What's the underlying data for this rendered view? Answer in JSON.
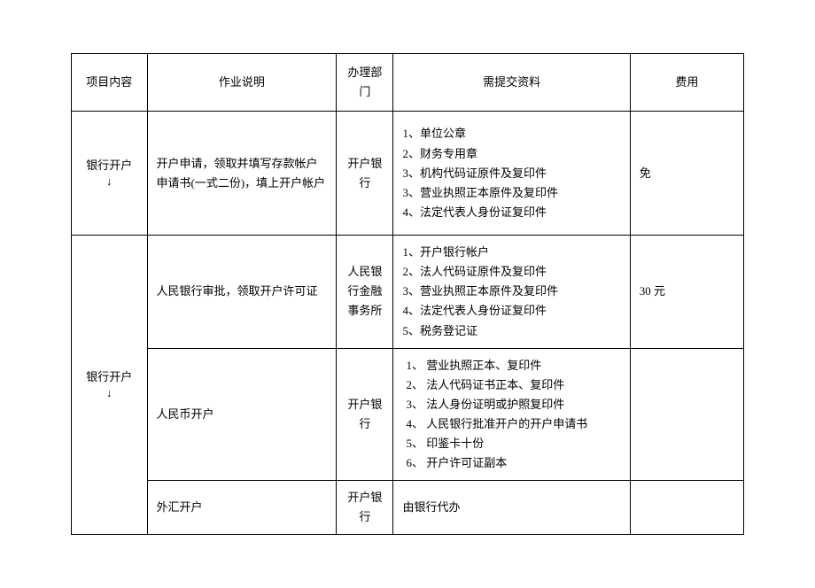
{
  "headers": {
    "project": "项目内容",
    "description": "作业说明",
    "department": "办理部门",
    "documents": "需提交资料",
    "fee": "费用"
  },
  "rows": [
    {
      "project": "银行开户\n↓",
      "description": "开户申请，领取并填写存款帐户申请书(一式二份)，填上开户帐户",
      "department": "开户银行",
      "documents": "1、单位公章\n2、财务专用章\n3、机构代码证原件及复印件\n3、营业执照正本原件及复印件\n4、法定代表人身份证复印件",
      "fee": "免"
    },
    {
      "project": "银行开户\n↓",
      "subrows": [
        {
          "description": "人民银行审批，领取开户许可证",
          "department": "人民银行金融事务所",
          "documents": "1、开户银行帐户\n2、法人代码证原件及复印件\n3、营业执照正本原件及复印件\n4、法定代表人身份证复印件\n5、税务登记证",
          "fee": "30 元"
        },
        {
          "description": "人民币开户",
          "department": "开户银行",
          "documents": "1、 营业执照正本、复印件\n2、 法人代码证书正本、复印件\n3、 法人身份证明或护照复印件\n4、 人民银行批准开户的开户申请书\n5、 印鉴卡十份\n6、 开户许可证副本",
          "fee": ""
        },
        {
          "description": "外汇开户",
          "department": "开户银行",
          "documents": "由银行代办",
          "fee": ""
        }
      ]
    }
  ]
}
